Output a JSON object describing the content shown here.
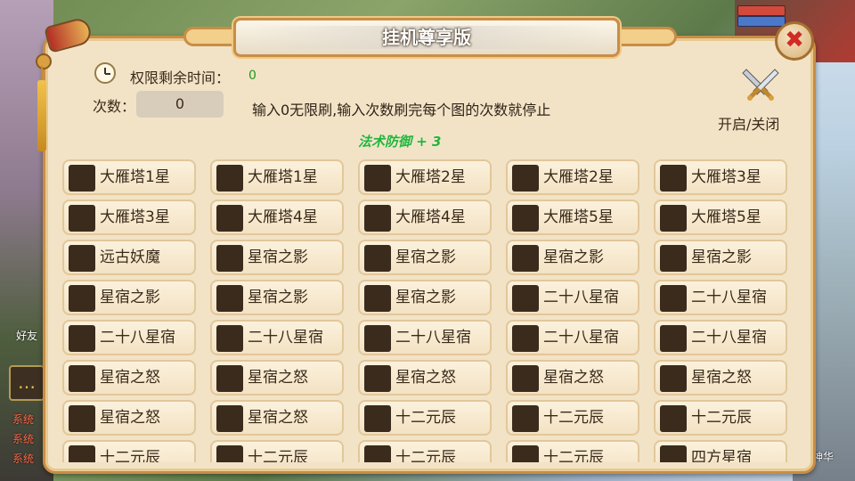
{
  "dialog": {
    "title": "挂机尊享版",
    "time_label": "权限剩余时间：",
    "time_value": "0",
    "count_label": "次数：",
    "count_value": "0",
    "hint": "输入0无限刷,输入次数刷完每个图的次数就停止",
    "bonus": "法术防御 + 3",
    "toggle_label": "开启/关闭",
    "close_glyph": "✖"
  },
  "colors": {
    "panel_bg": "#f2e3c7",
    "panel_border": "#c98d45",
    "checkbox": "#3b2b1d",
    "bonus_text": "#26b33a",
    "time_value": "#1f9a1f",
    "close_x": "#d22b24"
  },
  "icons": [
    "horn-icon",
    "clock-icon",
    "crossed-swords-icon",
    "close-icon",
    "chat-icon"
  ],
  "grid": {
    "columns": 5,
    "items": [
      "大雁塔1星",
      "大雁塔1星",
      "大雁塔2星",
      "大雁塔2星",
      "大雁塔3星",
      "大雁塔3星",
      "大雁塔4星",
      "大雁塔4星",
      "大雁塔5星",
      "大雁塔5星",
      "远古妖魔",
      "星宿之影",
      "星宿之影",
      "星宿之影",
      "星宿之影",
      "星宿之影",
      "星宿之影",
      "星宿之影",
      "二十八星宿",
      "二十八星宿",
      "二十八星宿",
      "二十八星宿",
      "二十八星宿",
      "二十八星宿",
      "二十八星宿",
      "星宿之怒",
      "星宿之怒",
      "星宿之怒",
      "星宿之怒",
      "星宿之怒",
      "星宿之怒",
      "星宿之怒",
      "十二元辰",
      "十二元辰",
      "十二元辰",
      "十二元辰",
      "十二元辰",
      "十二元辰",
      "十二元辰",
      "四方星宿"
    ]
  },
  "background": {
    "side_texts": [
      "好友",
      "系统",
      "系统",
      "系统",
      "战神华"
    ]
  }
}
